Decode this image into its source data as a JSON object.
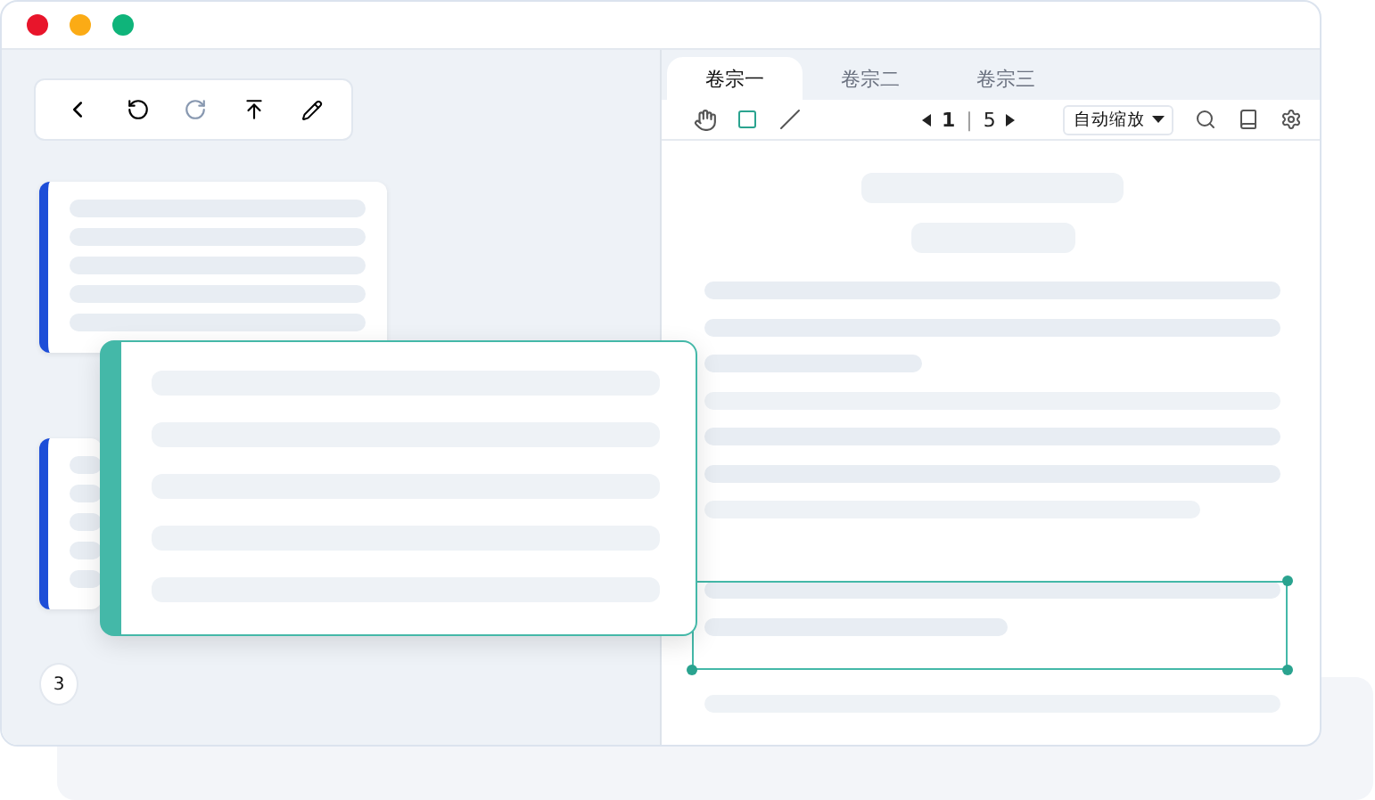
{
  "tabs": [
    {
      "label": "卷宗一",
      "selected": true
    },
    {
      "label": "卷宗二",
      "selected": false
    },
    {
      "label": "卷宗三",
      "selected": false
    }
  ],
  "tools": [
    {
      "kind": "hand",
      "selected": false
    },
    {
      "kind": "rect",
      "selected": true
    },
    {
      "kind": "line",
      "selected": false
    }
  ],
  "pager": {
    "current": "1",
    "separator": "|",
    "total": "5"
  },
  "zoom": {
    "value": "自动缩放"
  },
  "badge": "3"
}
